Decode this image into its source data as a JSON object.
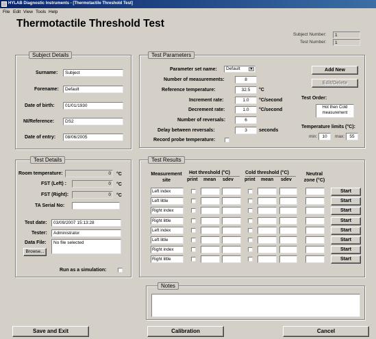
{
  "window": {
    "title": "HYLAB Diagnostic Instruments - [Thermotactile Threshold Test]"
  },
  "menu": [
    "File",
    "Edit",
    "View",
    "Tools",
    "Help"
  ],
  "page_title": "Thermotactile Threshold Test",
  "header": {
    "subject_number_label": "Subject Number:",
    "subject_number": "1",
    "test_number_label": "Test Number:",
    "test_number": "1"
  },
  "subject_details": {
    "title": "Subject Details",
    "surname_label": "Surname:",
    "surname": "Subject",
    "forename_label": "Forename:",
    "forename": "Default",
    "dob_label": "Date of birth:",
    "dob": "01/01/1930",
    "ni_label": "NI/Reference:",
    "ni": "DS2",
    "entry_label": "Date of entry:",
    "entry": "08/06/2005"
  },
  "test_parameters": {
    "title": "Test Parameters",
    "set_name_label": "Parameter set name:",
    "set_name": "Default",
    "num_measurements_label": "Number of measurements:",
    "num_measurements": "8",
    "ref_temp_label": "Reference temperature:",
    "ref_temp": "32.5",
    "ref_temp_unit": "°C",
    "increment_label": "Increment rate:",
    "increment": "1.0",
    "increment_unit": "°C/second",
    "decrement_label": "Decrement rate:",
    "decrement": "1.0",
    "decrement_unit": "°C/second",
    "reversals_label": "Number of reversals:",
    "reversals": "6",
    "delay_label": "Delay between reversals:",
    "delay": "3",
    "delay_unit": "seconds",
    "record_label": "Record probe temperature:",
    "add_new": "Add New",
    "edit_delete": "Edit/Delete",
    "test_order_label": "Test Order:",
    "test_order": "Hot then Cold measurement",
    "temp_limits_label": "Temperature limits (°C):",
    "min_label": "min:",
    "min": "10",
    "max_label": "max:",
    "max": "55"
  },
  "test_details": {
    "title": "Test Details",
    "room_temp_label": "Room temperature:",
    "room_temp": "0",
    "room_temp_unit": "°C",
    "fst_left_label": "FST (Left) :",
    "fst_left": "0",
    "fst_left_unit": "°C",
    "fst_right_label": "FST (Right):",
    "fst_right": "0",
    "fst_right_unit": "°C",
    "ta_serial_label": "TA Serial No:",
    "ta_serial": "",
    "test_date_label": "Test date:",
    "test_date": "03/09/2007 15:13:28",
    "tester_label": "Tester:",
    "tester": "Administrator",
    "data_file_label": "Data File:",
    "data_file": "No file selected",
    "browse": "Browse...",
    "simulation_label": "Run as a simulation:"
  },
  "test_results": {
    "title": "Test Results",
    "site_header": "Measurement site",
    "hot_header": "Hot threshold (°C)",
    "cold_header": "Cold threshold (°C)",
    "neutral_header": "Neutral zone (°C)",
    "print": "print",
    "mean": "mean",
    "sdev": "sdev",
    "rows": [
      {
        "site": "Left index",
        "action": "Start"
      },
      {
        "site": "Left little",
        "action": "Start"
      },
      {
        "site": "Right index",
        "action": "Start"
      },
      {
        "site": "Right little",
        "action": "Start"
      },
      {
        "site": "Left index",
        "action": "Start"
      },
      {
        "site": "Left little",
        "action": "Start"
      },
      {
        "site": "Right index",
        "action": "Start"
      },
      {
        "site": "Right little",
        "action": "Start"
      }
    ]
  },
  "notes": {
    "title": "Notes",
    "text": ""
  },
  "footer": {
    "save_exit": "Save and Exit",
    "calibration": "Calibration",
    "cancel": "Cancel"
  }
}
